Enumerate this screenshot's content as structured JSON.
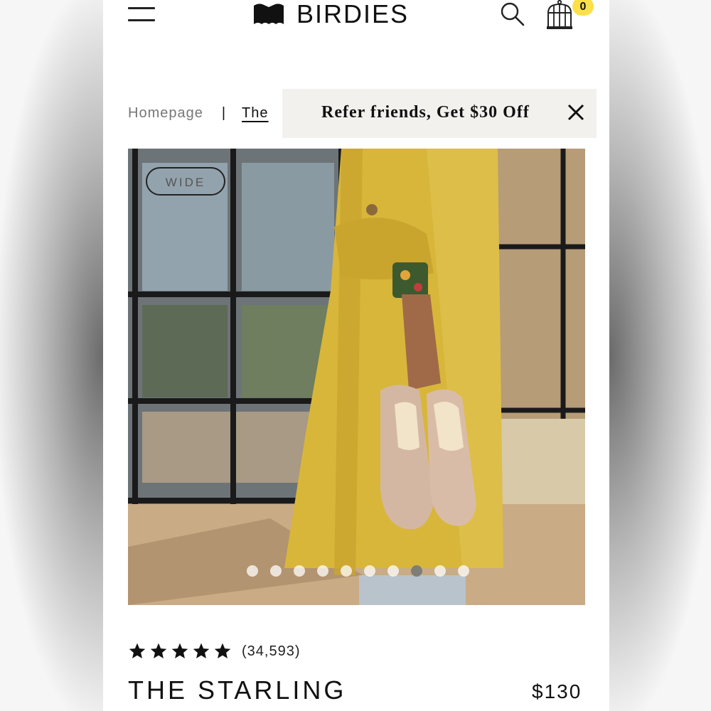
{
  "brand": {
    "name": "BIRDIES"
  },
  "header": {
    "cart_count": "0"
  },
  "breadcrumb": {
    "home": "Homepage",
    "separator": "|",
    "current": "The"
  },
  "promo": {
    "text": "Refer friends, Get $30 Off"
  },
  "gallery": {
    "badge": "WIDE",
    "slide_count": 10,
    "active_slide_index": 7
  },
  "product": {
    "rating_stars": 5,
    "review_count": "(34,593)",
    "name": "THE STARLING",
    "price": "$130"
  },
  "colors": {
    "accent_badge": "#fbe04a",
    "text": "#111111",
    "promo_bg": "#f2f1ee"
  },
  "icons": [
    "menu-icon",
    "birdies-logo-icon",
    "search-icon",
    "birdcage-cart-icon",
    "close-icon",
    "star-icon"
  ]
}
